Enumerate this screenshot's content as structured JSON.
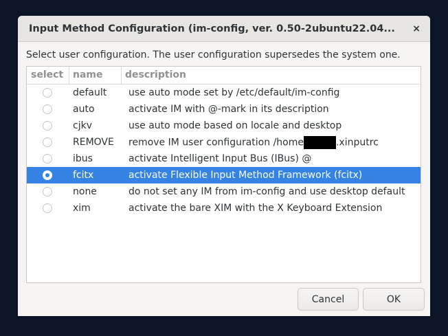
{
  "window": {
    "title": "Input Method Configuration (im-config, ver. 0.50-2ubuntu22.04...",
    "close": "×"
  },
  "message": "Select user configuration. The user configuration supersedes the system one.",
  "columns": [
    "select",
    "name",
    "description"
  ],
  "rows": [
    {
      "name": "default",
      "description": "use auto mode set by /etc/default/im-config",
      "selected": false
    },
    {
      "name": "auto",
      "description": "activate IM with @-mark in its description",
      "selected": false
    },
    {
      "name": "cjkv",
      "description": "use auto mode based on locale and desktop",
      "selected": false
    },
    {
      "name": "REMOVE",
      "description": "remove IM user configuration /home",
      "description_suffix": ".xinputrc",
      "selected": false
    },
    {
      "name": "ibus",
      "description": "activate Intelligent Input Bus (IBus) @",
      "selected": false
    },
    {
      "name": "fcitx",
      "description": "activate Flexible Input Method Framework (fcitx)",
      "selected": true
    },
    {
      "name": "none",
      "description": "do not set any IM from im-config and use desktop default",
      "selected": false
    },
    {
      "name": "xim",
      "description": "activate the bare XIM with the X Keyboard Extension",
      "selected": false
    }
  ],
  "buttons": {
    "cancel": "Cancel",
    "ok": "OK"
  },
  "colors": {
    "selection": "#3584e4"
  }
}
